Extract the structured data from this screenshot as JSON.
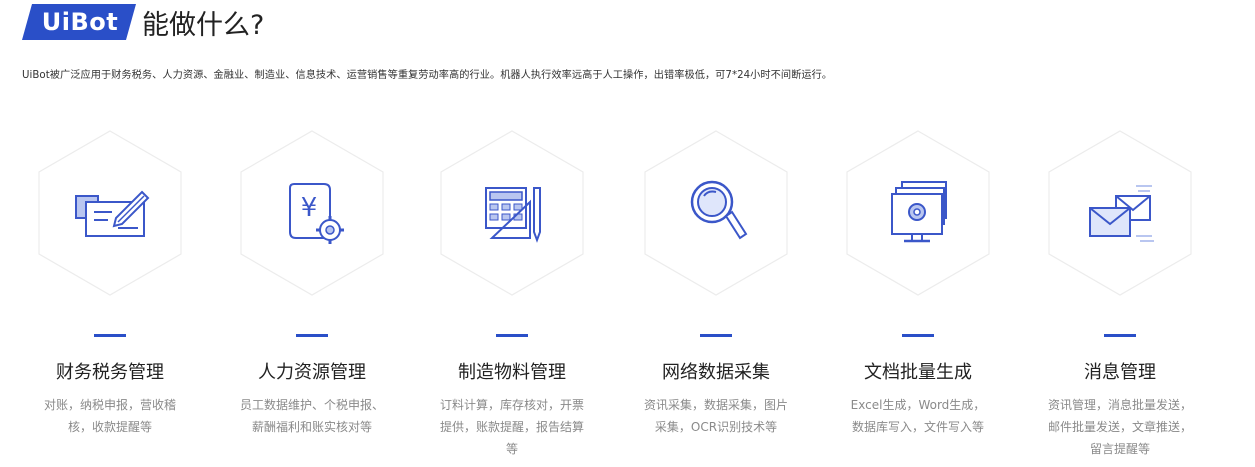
{
  "header": {
    "brand": "UiBot",
    "title_suffix": "能做什么?",
    "intro": "UiBot被广泛应用于财务税务、人力资源、金融业、制造业、信息技术、运营销售等重复劳动率高的行业。机器人执行效率远高于人工操作，出错率极低，可7*24小时不间断运行。"
  },
  "colors": {
    "brand_blue": "#2a4fc8",
    "icon_blue": "#3b57c9",
    "hex_border": "#ececec"
  },
  "cards": [
    {
      "icon": "invoice-pen-icon",
      "title": "财务税务管理",
      "desc": "对账，纳税申报，营收稽核，收款提醒等"
    },
    {
      "icon": "yuan-document-gear-icon",
      "title": "人力资源管理",
      "desc": "员工数据维护、个税申报、薪酬福利和账实核对等"
    },
    {
      "icon": "calculator-ruler-pencil-icon",
      "title": "制造物料管理",
      "desc": "订料计算，库存核对，开票提供，账款提醒，报告结算等"
    },
    {
      "icon": "magnifier-icon",
      "title": "网络数据采集",
      "desc": "资讯采集，数据采集，图片采集，OCR识别技术等"
    },
    {
      "icon": "monitor-gear-icon",
      "title": "文档批量生成",
      "desc": "Excel生成，Word生成，数据库写入，文件写入等"
    },
    {
      "icon": "envelopes-icon",
      "title": "消息管理",
      "desc": "资讯管理，消息批量发送，邮件批量发送，文章推送，留言提醒等"
    }
  ]
}
